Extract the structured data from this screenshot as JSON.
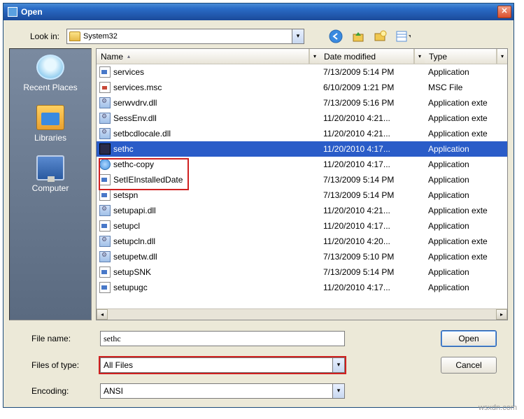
{
  "window": {
    "title": "Open"
  },
  "lookin": {
    "label": "Look in:",
    "value": "System32"
  },
  "places": [
    {
      "label": "Recent Places",
      "iconClass": "p-recent"
    },
    {
      "label": "Libraries",
      "iconClass": "p-lib"
    },
    {
      "label": "Computer",
      "iconClass": "p-comp"
    }
  ],
  "columns": {
    "name": "Name",
    "date": "Date modified",
    "type": "Type"
  },
  "files": [
    {
      "name": "services",
      "date": "7/13/2009 5:14 PM",
      "type": "Application",
      "icon": "i-app"
    },
    {
      "name": "services.msc",
      "date": "6/10/2009 1:21 PM",
      "type": "MSC File",
      "icon": "i-msc"
    },
    {
      "name": "serwvdrv.dll",
      "date": "7/13/2009 5:16 PM",
      "type": "Application exte",
      "icon": "i-dll"
    },
    {
      "name": "SessEnv.dll",
      "date": "11/20/2010 4:21...",
      "type": "Application exte",
      "icon": "i-dll"
    },
    {
      "name": "setbcdlocale.dll",
      "date": "11/20/2010 4:21...",
      "type": "Application exte",
      "icon": "i-dll"
    },
    {
      "name": "sethc",
      "date": "11/20/2010 4:17...",
      "type": "Application",
      "icon": "i-exe-sel",
      "selected": true
    },
    {
      "name": "sethc-copy",
      "date": "11/20/2010 4:17...",
      "type": "Application",
      "icon": "i-copy"
    },
    {
      "name": "SetIEInstalledDate",
      "date": "7/13/2009 5:14 PM",
      "type": "Application",
      "icon": "i-app"
    },
    {
      "name": "setspn",
      "date": "7/13/2009 5:14 PM",
      "type": "Application",
      "icon": "i-app"
    },
    {
      "name": "setupapi.dll",
      "date": "11/20/2010 4:21...",
      "type": "Application exte",
      "icon": "i-dll"
    },
    {
      "name": "setupcl",
      "date": "11/20/2010 4:17...",
      "type": "Application",
      "icon": "i-app"
    },
    {
      "name": "setupcln.dll",
      "date": "11/20/2010 4:20...",
      "type": "Application exte",
      "icon": "i-dll"
    },
    {
      "name": "setupetw.dll",
      "date": "7/13/2009 5:10 PM",
      "type": "Application exte",
      "icon": "i-dll"
    },
    {
      "name": "setupSNK",
      "date": "7/13/2009 5:14 PM",
      "type": "Application",
      "icon": "i-app"
    },
    {
      "name": "setupugc",
      "date": "11/20/2010 4:17...",
      "type": "Application",
      "icon": "i-app"
    }
  ],
  "filename": {
    "label": "File name:",
    "value": "sethc"
  },
  "filter": {
    "label": "Files of type:",
    "value": "All Files"
  },
  "encoding": {
    "label": "Encoding:",
    "value": "ANSI"
  },
  "buttons": {
    "open": "Open",
    "cancel": "Cancel"
  },
  "watermark": "wsxdn.com"
}
